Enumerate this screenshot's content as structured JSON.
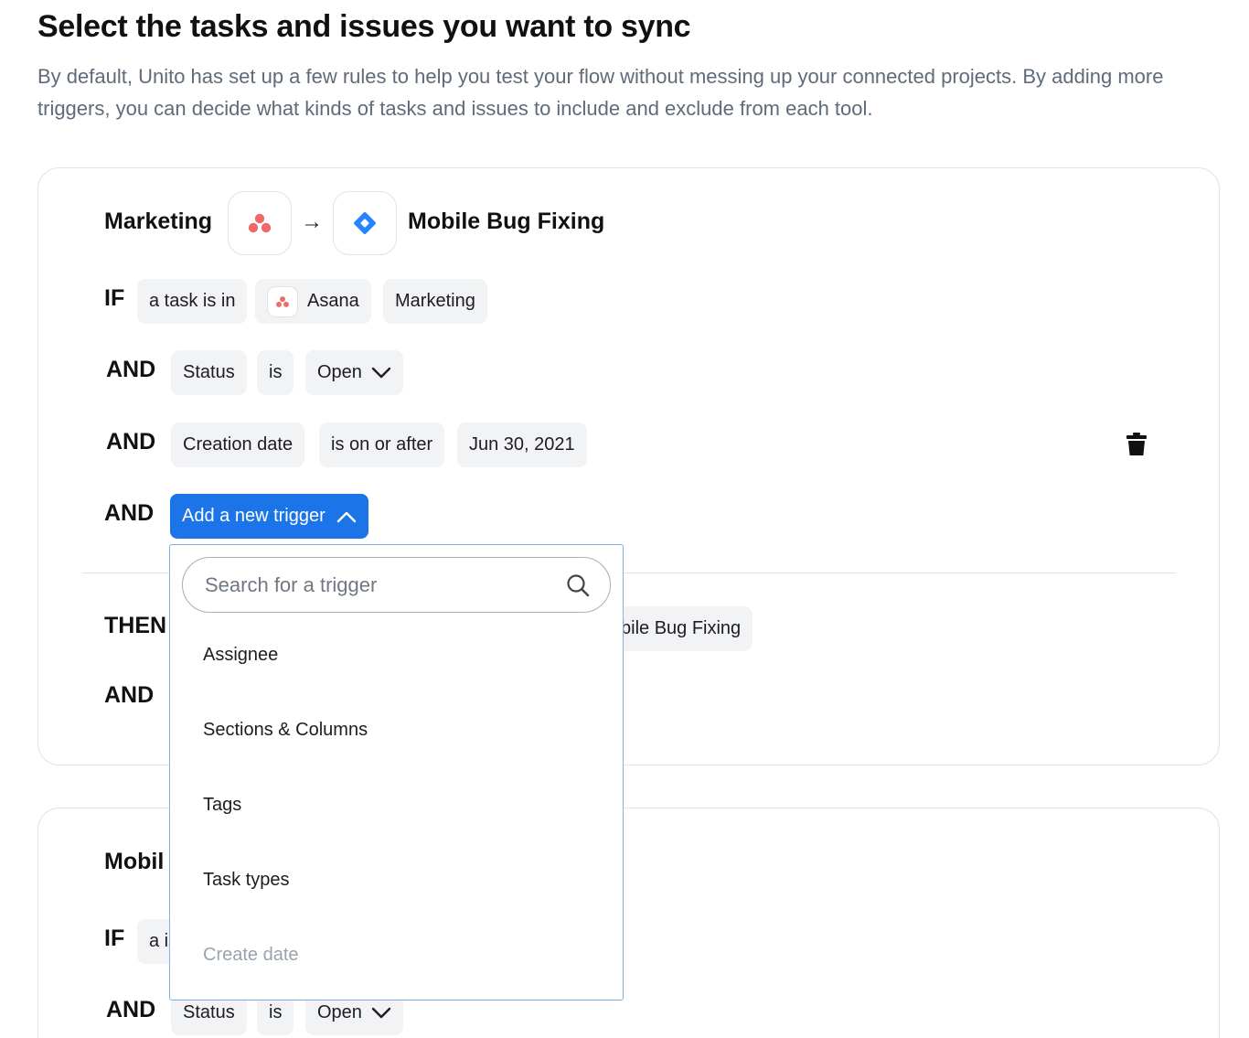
{
  "header": {
    "title": "Select the tasks and issues you want to sync",
    "subtitle": "By default, Unito has set up a few rules to help you test your flow without messing up your connected projects. By adding more triggers, you can decide what kinds of tasks and issues to include and exclude from each tool."
  },
  "colors": {
    "asana": "#f06a6a",
    "jira": "#2684ff",
    "primary": "#1b74e8"
  },
  "rule1": {
    "source": "Marketing",
    "arrow": "→",
    "target": "Mobile Bug Fixing",
    "source_icon": "asana-icon",
    "target_icon": "jira-icon",
    "if": {
      "keyword": "IF",
      "chips": [
        "a task is in",
        "Asana",
        "Marketing"
      ]
    },
    "and1": {
      "keyword": "AND",
      "field": "Status",
      "op": "is",
      "value": "Open"
    },
    "and2": {
      "keyword": "AND",
      "field": "Creation date",
      "op": "is on or after",
      "value": "Jun 30, 2021"
    },
    "and3": {
      "keyword": "AND",
      "button": "Add a new trigger"
    },
    "then": {
      "keyword": "THEN",
      "chip_partial": "bile Bug Fixing"
    },
    "and4": {
      "keyword": "AND"
    }
  },
  "rule2": {
    "title_partial": "Mobil",
    "if_keyword": "IF",
    "if_chip_partial": "a is",
    "and1": {
      "keyword": "AND",
      "field": "Status",
      "op": "is",
      "value": "Open"
    }
  },
  "dropdown": {
    "search_placeholder": "Search for a trigger",
    "options": [
      "Assignee",
      "Sections & Columns",
      "Tags",
      "Task types",
      "Create date"
    ]
  }
}
